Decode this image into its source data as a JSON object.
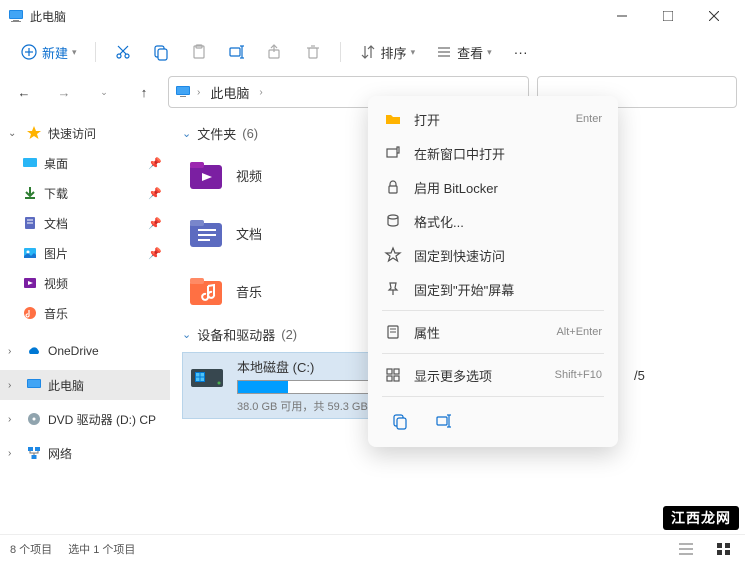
{
  "title": "此电脑",
  "toolbar": {
    "new_label": "新建",
    "sort_label": "排序",
    "view_label": "查看"
  },
  "address": {
    "root": "此电脑"
  },
  "sidebar": {
    "quick_access": "快速访问",
    "desktop": "桌面",
    "downloads": "下载",
    "documents": "文档",
    "pictures": "图片",
    "videos": "视频",
    "music": "音乐",
    "onedrive": "OneDrive",
    "this_pc": "此电脑",
    "dvd": "DVD 驱动器 (D:) CP",
    "network": "网络"
  },
  "sections": {
    "folders_label": "文件夹",
    "folders_count": "(6)",
    "devices_label": "设备和驱动器",
    "devices_count": "(2)"
  },
  "folders": {
    "videos": "视频",
    "documents": "文档",
    "music": "音乐"
  },
  "drive": {
    "name": "本地磁盘 (C:)",
    "subtext": "38.0 GB 可用，共 59.3 GB",
    "fill_pct": 36
  },
  "context_menu": {
    "open": "打开",
    "open_new": "在新窗口中打开",
    "bitlocker": "启用 BitLocker",
    "format": "格式化...",
    "pin_quick": "固定到快速访问",
    "pin_start": "固定到\"开始\"屏幕",
    "properties": "属性",
    "more_options": "显示更多选项",
    "acc_enter": "Enter",
    "acc_alt_enter": "Alt+Enter",
    "acc_shift_f10": "Shift+F10"
  },
  "overlay": {
    "v5": "/5"
  },
  "status": {
    "items": "8 个项目",
    "selected": "选中 1 个项目"
  },
  "watermark": "江西龙网"
}
